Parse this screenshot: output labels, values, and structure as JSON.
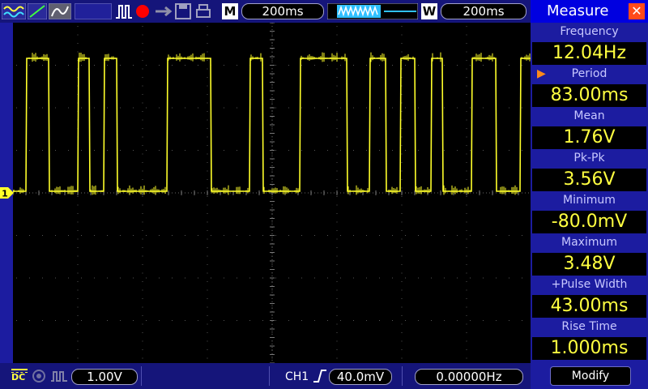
{
  "header": {
    "mode_indicator": "M",
    "main_timebase": "200ms",
    "window_indicator": "W",
    "window_timebase": "200ms"
  },
  "channel": {
    "marker": "1",
    "coupling_label": "DC",
    "volts_per_div": "1.00V",
    "trigger_source": "CH1",
    "trigger_level": "40.0mV",
    "frequency_counter": "0.00000Hz",
    "trace_color": "#ffff2a"
  },
  "measure": {
    "title": "Measure",
    "items": [
      {
        "label": "Frequency",
        "value": "12.04Hz",
        "selected": false
      },
      {
        "label": "Period",
        "value": "83.00ms",
        "selected": true
      },
      {
        "label": "Mean",
        "value": "1.76V",
        "selected": false
      },
      {
        "label": "Pk-Pk",
        "value": "3.56V",
        "selected": false
      },
      {
        "label": "Minimum",
        "value": "-80.0mV",
        "selected": false
      },
      {
        "label": "Maximum",
        "value": "3.48V",
        "selected": false
      },
      {
        "label": "+Pulse Width",
        "value": "43.00ms",
        "selected": false
      },
      {
        "label": "Rise Time",
        "value": "1.000ms",
        "selected": false
      }
    ],
    "modify_label": "Modify",
    "accent_color": "#0000e0",
    "value_color": "#ffff40"
  }
}
